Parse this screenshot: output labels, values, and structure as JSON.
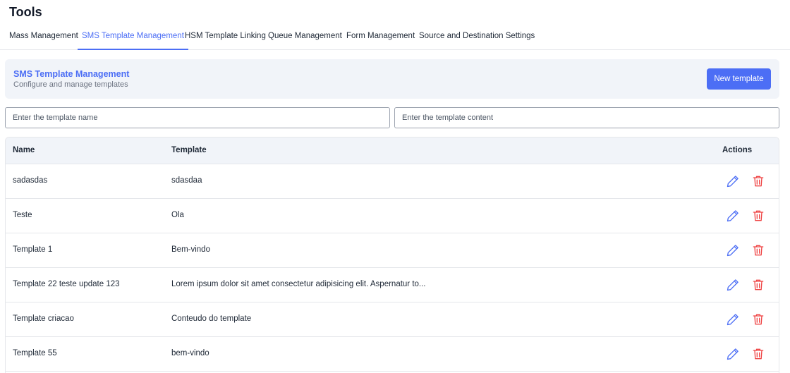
{
  "page": {
    "title": "Tools"
  },
  "tabs": [
    {
      "label": "Mass Management",
      "active": false
    },
    {
      "label": "SMS Template Management",
      "active": true
    },
    {
      "label": "HSM Template Linking",
      "active": false
    },
    {
      "label": "Queue Management",
      "active": false
    },
    {
      "label": "Form Management",
      "active": false
    },
    {
      "label": "Source and Destination Settings",
      "active": false
    }
  ],
  "header": {
    "title": "SMS Template Management",
    "subtitle": "Configure and manage templates",
    "new_button": "New template"
  },
  "filters": {
    "name_placeholder": "Enter the template name",
    "content_placeholder": "Enter the template content"
  },
  "table": {
    "columns": [
      "Name",
      "Template",
      "Actions"
    ],
    "rows": [
      {
        "name": "sadasdas",
        "template": "sdasdaa"
      },
      {
        "name": "Teste",
        "template": "Ola"
      },
      {
        "name": "Template 1",
        "template": "Bem-vindo"
      },
      {
        "name": "Template 22 teste update 123",
        "template": "Lorem ipsum dolor sit amet consectetur adipisicing elit. Aspernatur to..."
      },
      {
        "name": "Template criacao",
        "template": "Conteudo do template"
      },
      {
        "name": "Template 55",
        "template": "bem-vindo"
      }
    ]
  },
  "icons": {
    "edit": "pencil-icon",
    "delete": "trash-icon"
  },
  "colors": {
    "accent": "#4c6ef5",
    "danger": "#ef4444",
    "header_bg": "#f1f4f9"
  }
}
